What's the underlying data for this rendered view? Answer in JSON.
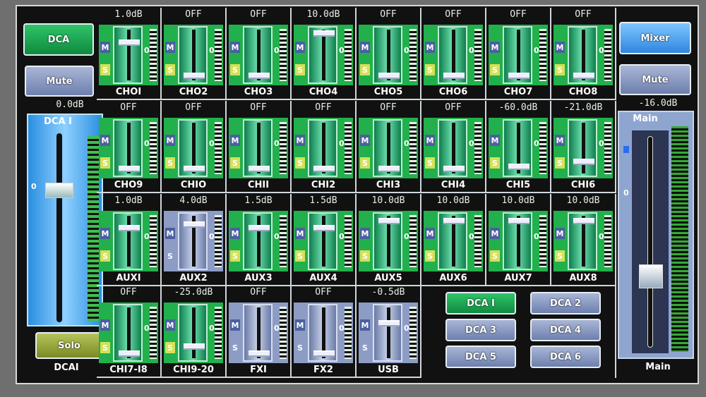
{
  "left": {
    "dca_button": "DCA",
    "mute_button": "Mute",
    "value": "0.0dB",
    "fader_title": "DCA I",
    "zero_mark": "0",
    "fader_level": 0.72,
    "solo_button": "Solo",
    "label": "DCAI"
  },
  "right": {
    "mixer_button": "Mixer",
    "mute_button": "Mute",
    "value": "-16.0dB",
    "fader_title": "Main",
    "zero_mark": "0",
    "fader_level": 0.35,
    "label": "Main"
  },
  "strip_buttons": {
    "mute": "M",
    "solo": "S",
    "zero": "0"
  },
  "strips": [
    {
      "name": "CHOI",
      "value": "1.0dB",
      "level": 0.78,
      "color": "green"
    },
    {
      "name": "CHO2",
      "value": "OFF",
      "level": 0.05,
      "color": "green"
    },
    {
      "name": "CHO3",
      "value": "OFF",
      "level": 0.05,
      "color": "green"
    },
    {
      "name": "CHO4",
      "value": "10.0dB",
      "level": 0.98,
      "color": "green"
    },
    {
      "name": "CHO5",
      "value": "OFF",
      "level": 0.05,
      "color": "green"
    },
    {
      "name": "CHO6",
      "value": "OFF",
      "level": 0.05,
      "color": "green"
    },
    {
      "name": "CHO7",
      "value": "OFF",
      "level": 0.05,
      "color": "green"
    },
    {
      "name": "CHO8",
      "value": "OFF",
      "level": 0.05,
      "color": "green"
    },
    {
      "name": "CHO9",
      "value": "OFF",
      "level": 0.05,
      "color": "green"
    },
    {
      "name": "CHIO",
      "value": "OFF",
      "level": 0.05,
      "color": "green"
    },
    {
      "name": "CHII",
      "value": "OFF",
      "level": 0.05,
      "color": "green"
    },
    {
      "name": "CHI2",
      "value": "OFF",
      "level": 0.05,
      "color": "green"
    },
    {
      "name": "CHI3",
      "value": "OFF",
      "level": 0.05,
      "color": "green"
    },
    {
      "name": "CHI4",
      "value": "OFF",
      "level": 0.05,
      "color": "green"
    },
    {
      "name": "CHI5",
      "value": "-60.0dB",
      "level": 0.1,
      "color": "green"
    },
    {
      "name": "CHI6",
      "value": "-21.0dB",
      "level": 0.2,
      "color": "green"
    },
    {
      "name": "AUXI",
      "value": "1.0dB",
      "level": 0.8,
      "color": "green"
    },
    {
      "name": "AUX2",
      "value": "4.0dB",
      "level": 0.88,
      "color": "blue"
    },
    {
      "name": "AUX3",
      "value": "1.5dB",
      "level": 0.8,
      "color": "green"
    },
    {
      "name": "AUX4",
      "value": "1.5dB",
      "level": 0.8,
      "color": "green"
    },
    {
      "name": "AUX5",
      "value": "10.0dB",
      "level": 0.95,
      "color": "green"
    },
    {
      "name": "AUX6",
      "value": "10.0dB",
      "level": 0.95,
      "color": "green"
    },
    {
      "name": "AUX7",
      "value": "10.0dB",
      "level": 0.95,
      "color": "green"
    },
    {
      "name": "AUX8",
      "value": "10.0dB",
      "level": 0.95,
      "color": "green"
    },
    {
      "name": "CHI7-I8",
      "value": "OFF",
      "level": 0.05,
      "color": "green"
    },
    {
      "name": "CHI9-20",
      "value": "-25.0dB",
      "level": 0.2,
      "color": "green"
    },
    {
      "name": "FXI",
      "value": "OFF",
      "level": 0.05,
      "color": "blue"
    },
    {
      "name": "FX2",
      "value": "OFF",
      "level": 0.05,
      "color": "blue"
    },
    {
      "name": "USB",
      "value": "-0.5dB",
      "level": 0.72,
      "color": "blue"
    }
  ],
  "dca_groups": [
    {
      "label": "DCA I",
      "active": true
    },
    {
      "label": "DCA 2",
      "active": false
    },
    {
      "label": "DCA 3",
      "active": false
    },
    {
      "label": "DCA 4",
      "active": false
    },
    {
      "label": "DCA 5",
      "active": false
    },
    {
      "label": "DCA 6",
      "active": false
    }
  ]
}
